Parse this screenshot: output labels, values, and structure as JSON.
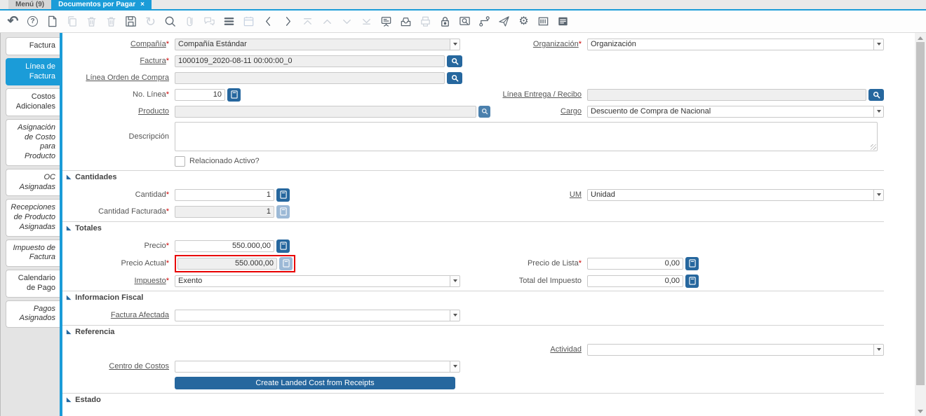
{
  "ui": {
    "required_marker": "*",
    "close_icon": "×",
    "section_triangle": "◢"
  },
  "colors": {
    "accent_blue": "#1b9cd8",
    "button_blue": "#26679e",
    "highlight_red": "#e80000"
  },
  "tabbar": {
    "menu_tab": "Menú (9)",
    "window_tab": "Documentos por Pagar"
  },
  "toolbar": {
    "icons": [
      {
        "name": "undo-icon",
        "enabled": true,
        "glyph": "↶"
      },
      {
        "name": "help-icon",
        "enabled": true,
        "glyph": "?"
      },
      {
        "name": "new-record-icon",
        "enabled": true
      },
      {
        "name": "copy-record-icon",
        "enabled": false
      },
      {
        "name": "delete-record-icon",
        "enabled": false
      },
      {
        "name": "delete-selection-icon",
        "enabled": false
      },
      {
        "name": "save-icon",
        "enabled": true
      },
      {
        "name": "refresh-icon",
        "enabled": false,
        "glyph": "↻"
      },
      {
        "name": "find-icon",
        "enabled": true
      },
      {
        "name": "attachment-icon",
        "enabled": false
      },
      {
        "name": "chat-icon",
        "enabled": false
      },
      {
        "name": "grid-toggle-icon",
        "enabled": true
      },
      {
        "name": "calendar-icon",
        "enabled": false
      },
      {
        "name": "parent-record-icon",
        "enabled": true
      },
      {
        "name": "detail-record-icon",
        "enabled": true
      },
      {
        "name": "first-record-icon",
        "enabled": false
      },
      {
        "name": "previous-record-icon",
        "enabled": false
      },
      {
        "name": "next-record-icon",
        "enabled": false
      },
      {
        "name": "last-record-icon",
        "enabled": false
      },
      {
        "name": "report-icon",
        "enabled": true
      },
      {
        "name": "archive-icon",
        "enabled": true
      },
      {
        "name": "print-icon",
        "enabled": false
      },
      {
        "name": "lock-icon",
        "enabled": true
      },
      {
        "name": "zoom-across-icon",
        "enabled": true
      },
      {
        "name": "workflow-icon",
        "enabled": true
      },
      {
        "name": "send-request-icon",
        "enabled": true
      },
      {
        "name": "process-icon",
        "enabled": true,
        "glyph": "⚙"
      },
      {
        "name": "product-info-icon",
        "enabled": true
      },
      {
        "name": "report-layout-icon",
        "enabled": true
      }
    ]
  },
  "sidebar": {
    "tabs": [
      {
        "label": "Factura",
        "active": false,
        "italic": false
      },
      {
        "label": "Línea de Factura",
        "active": true,
        "italic": false
      },
      {
        "label": "Costos Adicionales",
        "active": false,
        "italic": false
      },
      {
        "label": "Asignación de Costo para Producto",
        "active": false,
        "italic": true
      },
      {
        "label": "OC Asignadas",
        "active": false,
        "italic": true
      },
      {
        "label": "Recepciones de Producto Asignadas",
        "active": false,
        "italic": true
      },
      {
        "label": "Impuesto de Factura",
        "active": false,
        "italic": true
      },
      {
        "label": "Calendario de Pago",
        "active": false,
        "italic": false
      },
      {
        "label": "Pagos Asignados",
        "active": false,
        "italic": true
      }
    ]
  },
  "form": {
    "compania": {
      "label": "Compañía",
      "value": "Compañía Estándar"
    },
    "organizacion": {
      "label": "Organización",
      "value": "Organización"
    },
    "factura": {
      "label": "Factura",
      "value": "1000109_2020-08-11 00:00:00_0"
    },
    "linea_orden_compra": {
      "label": "Línea Orden de Compra",
      "value": ""
    },
    "no_linea": {
      "label": "No. Línea",
      "value": "10"
    },
    "linea_entrega": {
      "label": "Línea Entrega / Recibo",
      "value": ""
    },
    "producto": {
      "label": "Producto",
      "value": ""
    },
    "cargo": {
      "label": "Cargo",
      "value": "Descuento de Compra de Nacional"
    },
    "descripcion": {
      "label": "Descripción",
      "value": ""
    },
    "relacionado_activo": {
      "label": "Relacionado Activo?",
      "checked": false
    },
    "cantidades": {
      "title": "Cantidades",
      "cantidad": {
        "label": "Cantidad",
        "value": "1"
      },
      "um": {
        "label": "UM",
        "value": "Unidad"
      },
      "cantidad_facturada": {
        "label": "Cantidad Facturada",
        "value": "1"
      }
    },
    "totales": {
      "title": "Totales",
      "precio": {
        "label": "Precio",
        "value": "550.000,00"
      },
      "precio_actual": {
        "label": "Precio Actual",
        "value": "550.000,00"
      },
      "precio_lista": {
        "label": "Precio de Lista",
        "value": "0,00"
      },
      "impuesto": {
        "label": "Impuesto",
        "value": "Exento"
      },
      "total_impuesto": {
        "label": "Total del Impuesto",
        "value": "0,00"
      }
    },
    "informacion_fiscal": {
      "title": "Informacion Fiscal",
      "factura_afectada": {
        "label": "Factura Afectada",
        "value": ""
      }
    },
    "referencia": {
      "title": "Referencia",
      "actividad": {
        "label": "Actividad",
        "value": ""
      },
      "centro_costos": {
        "label": "Centro de Costos",
        "value": ""
      },
      "create_landed_cost_button": "Create Landed Cost from Receipts"
    },
    "estado": {
      "title": "Estado"
    }
  }
}
